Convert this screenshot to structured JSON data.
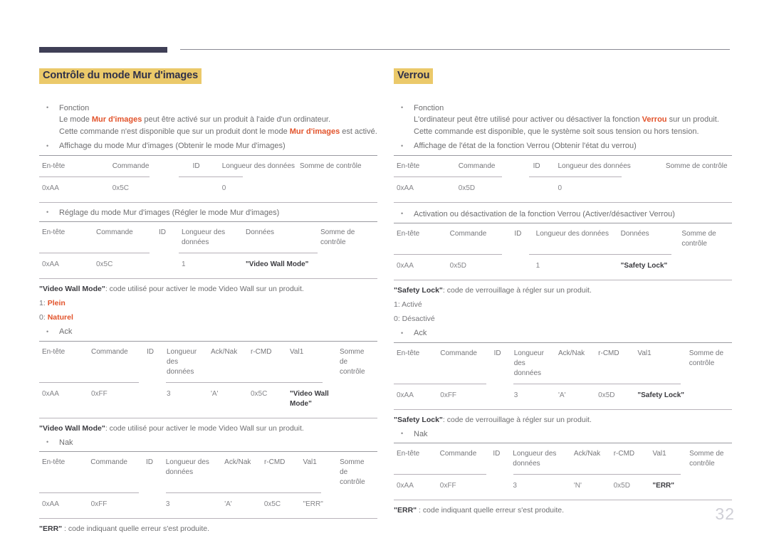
{
  "page": {
    "number": "32"
  },
  "left": {
    "title": "Contrôle du mode Mur d'images",
    "function_label": "Fonction",
    "function_line1_a": "Le mode ",
    "function_line1_b": "Mur d'images",
    "function_line1_c": " peut être activé sur un produit à l'aide d'un ordinateur.",
    "function_line2_a": "Cette commande n'est disponible que sur un produit dont le mode ",
    "function_line2_b": "Mur d'images",
    "function_line2_c": " est activé.",
    "get_label": "Affichage du mode Mur d'images (Obtenir le mode Mur d'images)",
    "get_table": {
      "headers": [
        "En-tête",
        "Commande",
        "ID",
        "Longueur des données",
        "Somme de contrôle"
      ],
      "row": [
        "0xAA",
        "0x5C",
        "",
        "0",
        ""
      ]
    },
    "set_label": "Réglage du mode Mur d'images (Régler le mode Mur d'images)",
    "set_table": {
      "headers": [
        "En-tête",
        "Commande",
        "ID",
        "Longueur des données",
        "Données",
        "Somme de contrôle"
      ],
      "row": [
        "0xAA",
        "0x5C",
        "",
        "1",
        "\"Video Wall Mode\"",
        ""
      ]
    },
    "note1_a": "\"Video Wall Mode\"",
    "note1_b": ": code utilisé pour activer le mode Video Wall sur un produit.",
    "enum1_key": "1: ",
    "enum1_val": "Plein",
    "enum2_key": "0: ",
    "enum2_val": "Naturel",
    "ack_label": "Ack",
    "ack_table": {
      "headers": [
        "En-tête",
        "Commande",
        "ID",
        "Longueur des données",
        "Ack/Nak",
        "r-CMD",
        "Val1",
        "Somme de contrôle"
      ],
      "row": [
        "0xAA",
        "0xFF",
        "",
        "3",
        "'A'",
        "0x5C",
        "\"Video Wall Mode\"",
        ""
      ]
    },
    "note2_a": "\"Video Wall Mode\"",
    "note2_b": ": code utilisé pour activer le mode Video Wall sur un produit.",
    "nak_label": "Nak",
    "nak_table": {
      "headers": [
        "En-tête",
        "Commande",
        "ID",
        "Longueur des données",
        "Ack/Nak",
        "r-CMD",
        "Val1",
        "Somme de contrôle"
      ],
      "row": [
        "0xAA",
        "0xFF",
        "",
        "3",
        "'A'",
        "0x5C",
        "\"ERR\"",
        ""
      ]
    },
    "note3_a": "\"ERR\"",
    "note3_b": " : code indiquant quelle erreur s'est produite."
  },
  "right": {
    "title": "Verrou",
    "function_label": "Fonction",
    "function_line1_a": "L'ordinateur peut être utilisé pour activer ou désactiver la fonction ",
    "function_line1_b": "Verrou",
    "function_line1_c": " sur un produit.",
    "function_line2": "Cette commande est disponible, que le système soit sous tension ou hors tension.",
    "get_label": "Affichage de l'état de la fonction Verrou (Obtenir l'état du verrou)",
    "get_table": {
      "headers": [
        "En-tête",
        "Commande",
        "ID",
        "Longueur des données",
        "Somme de contrôle"
      ],
      "row": [
        "0xAA",
        "0x5D",
        "",
        "0",
        ""
      ]
    },
    "set_label": "Activation ou désactivation de la fonction Verrou (Activer/désactiver Verrou)",
    "set_table": {
      "headers": [
        "En-tête",
        "Commande",
        "ID",
        "Longueur des données",
        "Données",
        "Somme de contrôle"
      ],
      "row": [
        "0xAA",
        "0x5D",
        "",
        "1",
        "\"Safety Lock\"",
        ""
      ]
    },
    "note1_a": "\"Safety Lock\"",
    "note1_b": ": code de verrouillage à régler sur un produit.",
    "enum1": "1: Activé",
    "enum2": "0: Désactivé",
    "ack_label": "Ack",
    "ack_table": {
      "headers": [
        "En-tête",
        "Commande",
        "ID",
        "Longueur des données",
        "Ack/Nak",
        "r-CMD",
        "Val1",
        "Somme de contrôle"
      ],
      "row": [
        "0xAA",
        "0xFF",
        "",
        "3",
        "'A'",
        "0x5D",
        "\"Safety Lock\"",
        ""
      ]
    },
    "note2_a": "\"Safety Lock\"",
    "note2_b": ": code de verrouillage à régler sur un produit.",
    "nak_label": "Nak",
    "nak_table": {
      "headers": [
        "En-tête",
        "Commande",
        "ID",
        "Longueur des données",
        "Ack/Nak",
        "r-CMD",
        "Val1",
        "Somme de contrôle"
      ],
      "row": [
        "0xAA",
        "0xFF",
        "",
        "3",
        "'N'",
        "0x5D",
        "\"ERR\"",
        ""
      ]
    },
    "note3_a": "\"ERR\"",
    "note3_b": " : code indiquant quelle erreur s'est produite."
  },
  "colors": {
    "accent_orange": "#e2532b",
    "title_highlight": "#ebc96a",
    "title_text": "#2f3049",
    "header_bar": "#3f3f56",
    "body_text": "#6e6e70"
  }
}
